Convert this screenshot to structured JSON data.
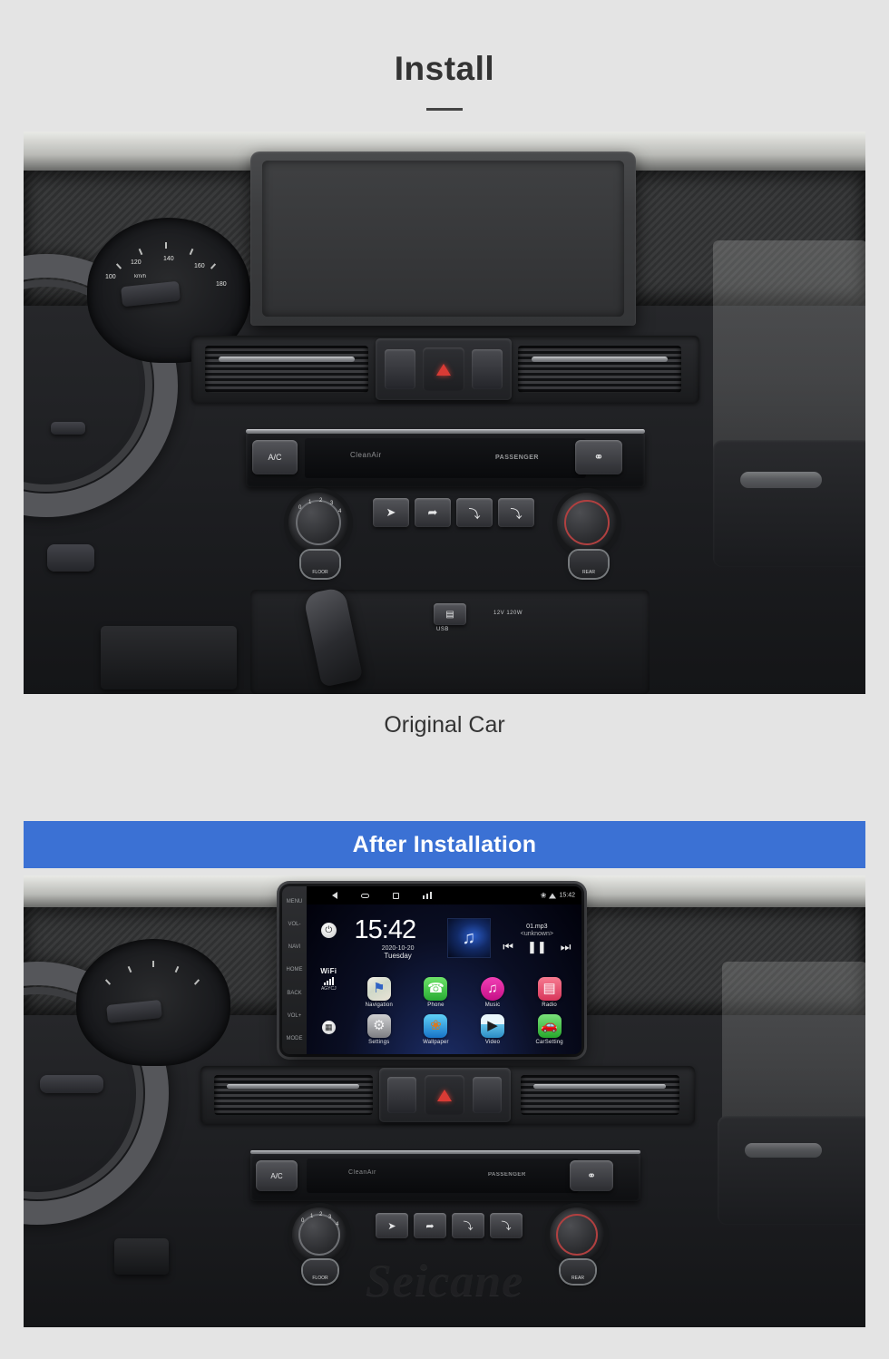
{
  "header": {
    "title": "Install"
  },
  "sections": {
    "original": {
      "caption": "Original Car",
      "photo_alt": "original-car-dashboard"
    },
    "installed": {
      "banner": "After  Installation",
      "photo_alt": "after-installation-dashboard",
      "watermark": "Seicane"
    }
  },
  "head_unit": {
    "status_bar": {
      "back_icon": "back-triangle-icon",
      "home_icon": "home-icon",
      "recents_icon": "recents-icon",
      "volume_icon": "volume-icon",
      "bluetooth_icon": "bluetooth-icon",
      "wifi_icon": "wifi-icon",
      "time": "15:42"
    },
    "hard_keys": [
      "MENU",
      "VOL-",
      "NAVI",
      "HOME",
      "BACK",
      "VOL+",
      "MODE"
    ],
    "left_rail": {
      "power_icon": "power-icon",
      "wifi_label": "WiFi",
      "wifi_ssid": "AGYCJ",
      "apps_icon": "all-apps-icon"
    },
    "clock_widget": {
      "time": "15:42",
      "date": "2020-10-20",
      "weekday": "Tuesday"
    },
    "music_widget": {
      "album_icon": "music-note-icon",
      "track": "01.mp3",
      "artist": "<unknown>",
      "prev_icon": "previous-track-icon",
      "play_pause_icon": "pause-icon",
      "next_icon": "next-track-icon"
    },
    "apps": [
      [
        {
          "label": "Navigation",
          "icon": "map-pin-icon",
          "color": "#e8e6df",
          "glyph": "⚑"
        },
        {
          "label": "Phone",
          "icon": "phone-icon",
          "color": "#3ec24a",
          "glyph": "☎"
        },
        {
          "label": "Music",
          "icon": "music-icon",
          "color": "#e2219b",
          "glyph": "♫"
        },
        {
          "label": "Radio",
          "icon": "radio-icon",
          "color": "#e8476b",
          "glyph": "▤"
        }
      ],
      [
        {
          "label": "Settings",
          "icon": "settings-gear-icon",
          "color": "#9a9b9e",
          "glyph": "⚙"
        },
        {
          "label": "Wallpaper",
          "icon": "wallpaper-icon",
          "color": "#2fa8e6",
          "glyph": "❀"
        },
        {
          "label": "Video",
          "icon": "video-clapper-icon",
          "color": "#6fc5ea",
          "glyph": "▶"
        },
        {
          "label": "CarSetting",
          "icon": "car-setting-icon",
          "color": "#4fc44f",
          "glyph": "⛁"
        }
      ]
    ]
  },
  "dashboard": {
    "hazard_icon": "hazard-triangle-icon",
    "rocker_left_icon": "rocker-switch-icon",
    "rocker_right_icon": "rocker-switch-icon",
    "climate": {
      "ac_button": "A/C",
      "clean_air_label": "CleanAir",
      "passenger_label": "PASSENGER",
      "defrost_button_icon": "rear-defrost-icon",
      "fan_knob_scale": [
        "0",
        "1",
        "2",
        "3",
        "4"
      ],
      "fan_knob_name": "fan-speed-knob",
      "temp_knob_name": "temperature-knob",
      "mode_buttons": [
        {
          "name": "windshield-defrost-button",
          "glyph": "➤"
        },
        {
          "name": "face-and-feet-button",
          "glyph": "➦"
        },
        {
          "name": "face-vent-button",
          "glyph": "⤵"
        },
        {
          "name": "feet-vent-button",
          "glyph": "⤵"
        }
      ],
      "floor_button_left": "FLOOR",
      "floor_button_right": "REAR"
    },
    "console": {
      "usb_label": "USB",
      "power_socket_label": "12V 120W",
      "shifter_name": "gear-shifter"
    },
    "cluster": {
      "unit_label": "km/h",
      "speed_ticks": [
        "100",
        "120",
        "140",
        "160",
        "180"
      ]
    }
  },
  "colors": {
    "page_background": "#e4e4e4",
    "banner_blue": "#3b71d4",
    "title_text": "#333333",
    "caption_text": "#333333",
    "hazard_red": "#d93b35"
  }
}
